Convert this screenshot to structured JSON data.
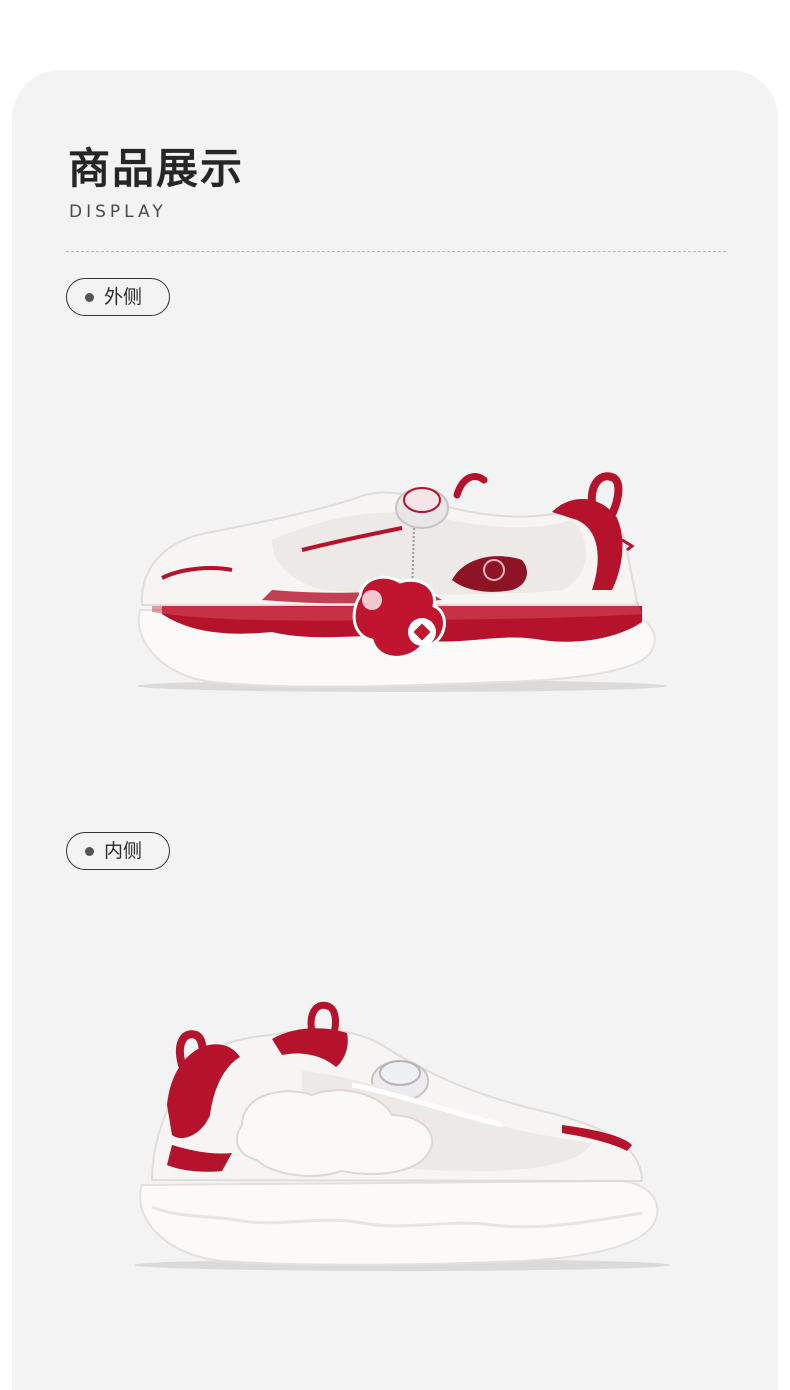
{
  "header": {
    "title": "商品展示",
    "subtitle": "DISPLAY"
  },
  "sections": [
    {
      "label": "外侧",
      "image": "shoe-outer-side"
    },
    {
      "label": "内侧",
      "image": "shoe-inner-side"
    }
  ],
  "colors": {
    "card_background": "#f4f3f3",
    "accent_red": "#b5122b",
    "shoe_white": "#f7f5f3"
  }
}
